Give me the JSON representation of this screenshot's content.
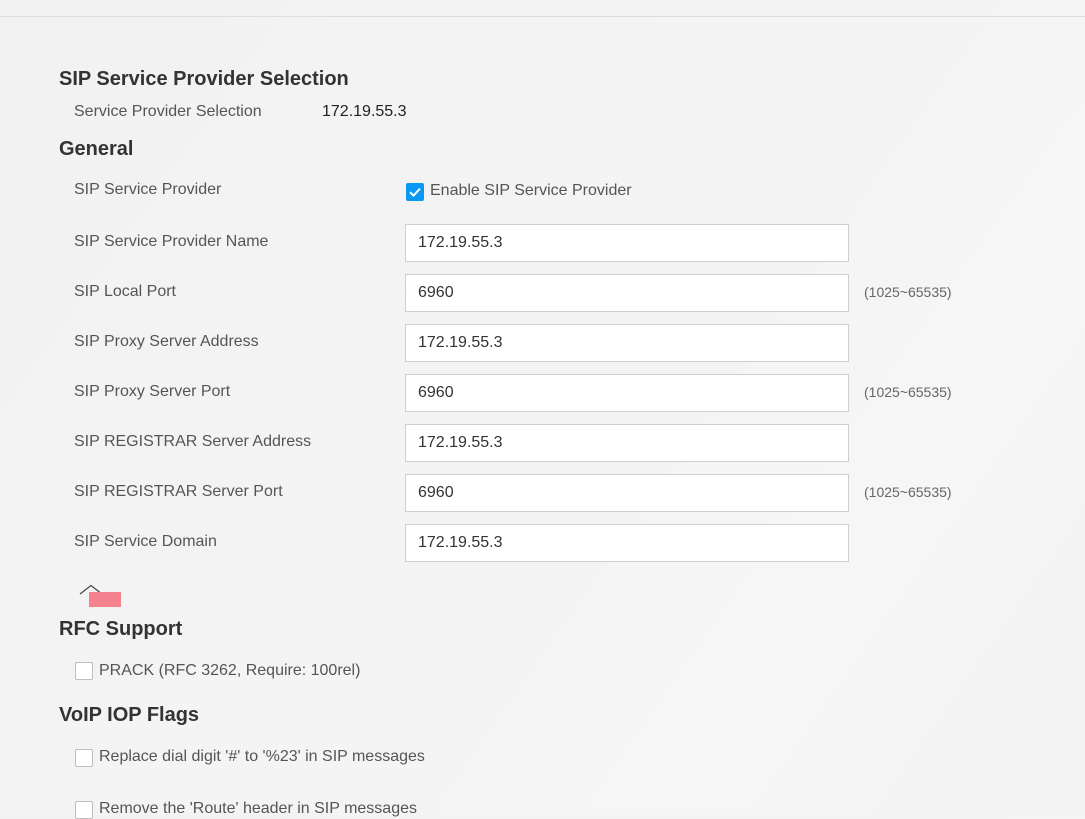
{
  "provider_selection": {
    "title": "SIP Service Provider Selection",
    "label": "Service Provider Selection",
    "value": "172.19.55.3"
  },
  "general": {
    "title": "General",
    "sip_service_provider": {
      "label": "SIP Service Provider",
      "checkbox_label": "Enable SIP Service Provider",
      "checked": true
    },
    "provider_name": {
      "label": "SIP Service Provider Name",
      "value": "172.19.55.3"
    },
    "local_port": {
      "label": "SIP Local Port",
      "value": "6960",
      "hint": "(1025~65535)"
    },
    "proxy_address": {
      "label": "SIP Proxy Server Address",
      "value": "172.19.55.3"
    },
    "proxy_port": {
      "label": "SIP Proxy Server Port",
      "value": "6960",
      "hint": "(1025~65535)"
    },
    "registrar_address": {
      "label": "SIP REGISTRAR Server Address",
      "value": "172.19.55.3"
    },
    "registrar_port": {
      "label": "SIP REGISTRAR Server Port",
      "value": "6960",
      "hint": "(1025~65535)"
    },
    "service_domain": {
      "label": "SIP Service Domain",
      "value": "172.19.55.3"
    }
  },
  "rfc_support": {
    "title": "RFC Support",
    "prack": {
      "label": "PRACK (RFC 3262, Require: 100rel)",
      "checked": false
    }
  },
  "voip_iop_flags": {
    "title": "VoIP IOP Flags",
    "replace_dial_digit": {
      "label": "Replace dial digit '#' to '%23' in SIP messages",
      "checked": false
    },
    "remove_route_header": {
      "label": "Remove the 'Route' header in SIP messages",
      "checked": false
    }
  },
  "colors": {
    "accent": "#0a98f5",
    "marker": "#f4838f"
  },
  "icons": {
    "collapse": "chevron-up-icon",
    "check": "checkmark-icon"
  }
}
